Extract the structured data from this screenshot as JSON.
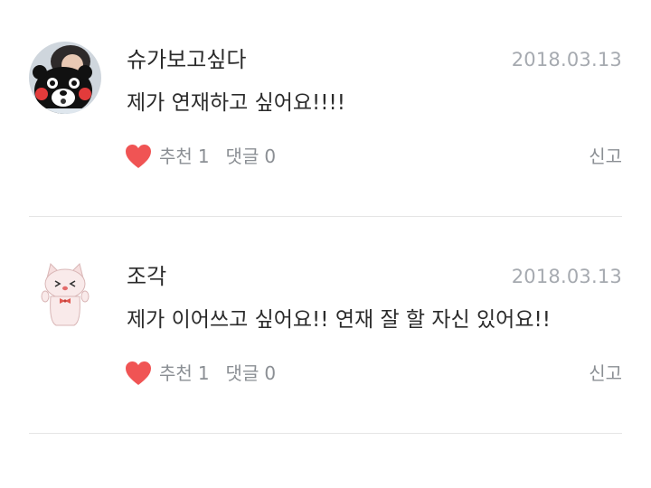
{
  "comments": [
    {
      "author": "슈가보고싶다",
      "date": "2018.03.13",
      "text": "제가 연재하고 싶어요!!!!",
      "like_label": "추천",
      "like_count": "1",
      "reply_label": "댓글",
      "reply_count": "0",
      "report_label": "신고",
      "avatar_icon": "kumamon-avatar-icon"
    },
    {
      "author": "조각",
      "date": "2018.03.13",
      "text": "제가 이어쓰고 싶어요!! 연재 잘 할 자신 있어요!!",
      "like_label": "추천",
      "like_count": "1",
      "reply_label": "댓글",
      "reply_count": "0",
      "report_label": "신고",
      "avatar_icon": "cat-avatar-icon"
    }
  ],
  "colors": {
    "heart": "#f05454",
    "text_primary": "#2b2b2b",
    "text_secondary": "#8b8f94",
    "date": "#a6aab0",
    "divider": "#e5e5e5"
  }
}
